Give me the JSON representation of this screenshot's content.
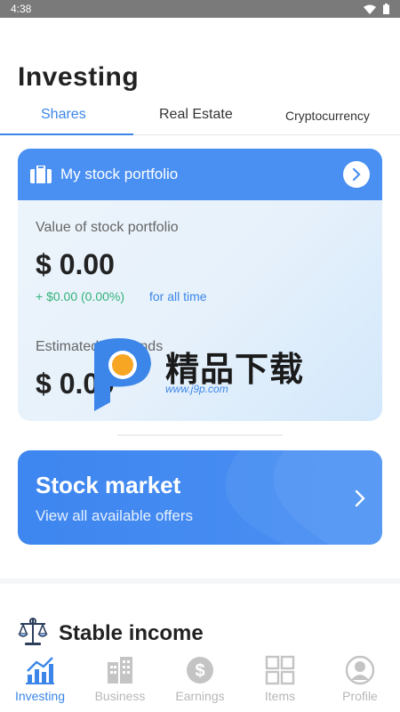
{
  "status_bar": {
    "time": "4:38"
  },
  "page": {
    "title": "Investing"
  },
  "tabs": [
    {
      "label": "Shares",
      "active": true
    },
    {
      "label": "Real Estate",
      "active": false
    },
    {
      "label": "Cryptocurrency",
      "active": false
    }
  ],
  "portfolio_card": {
    "header": "My stock portfolio",
    "value_label": "Value of stock portfolio",
    "value": "$ 0.00",
    "change": "+ $0.00 (0.00%)",
    "period": "for all time",
    "estimated_label": "Estimated dividends",
    "estimated_value": "$ 0.00"
  },
  "watermark": {
    "text": "精品下载",
    "url": "www.j9p.com"
  },
  "market_card": {
    "title": "Stock market",
    "subtitle": "View all available offers"
  },
  "income_section": {
    "title": "Stable income"
  },
  "bottom_nav": [
    {
      "label": "Investing",
      "icon": "bar-chart-icon",
      "active": true
    },
    {
      "label": "Business",
      "icon": "building-icon",
      "active": false
    },
    {
      "label": "Earnings",
      "icon": "dollar-coin-icon",
      "active": false
    },
    {
      "label": "Items",
      "icon": "grid-icon",
      "active": false
    },
    {
      "label": "Profile",
      "icon": "user-icon",
      "active": false
    }
  ],
  "colors": {
    "accent": "#3b86e8",
    "card_header": "#4a8ff2",
    "positive": "#34b27b",
    "inactive": "#b7b7b7"
  }
}
